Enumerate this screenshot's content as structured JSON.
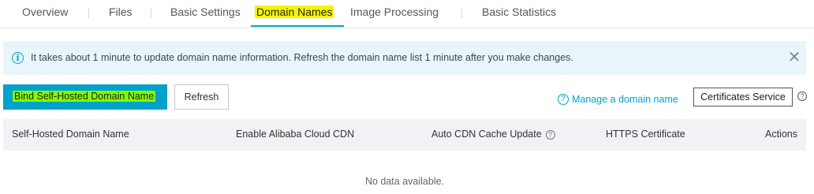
{
  "tabs": [
    {
      "label": "Overview"
    },
    {
      "label": "Files"
    },
    {
      "label": "Basic Settings"
    },
    {
      "label": "Domain Names",
      "active": true
    },
    {
      "label": "Image Processing"
    },
    {
      "label": "Basic Statistics"
    }
  ],
  "notice": {
    "icon": "info-icon",
    "text": "It takes about 1 minute to update domain name information. Refresh the domain name list 1 minute after you make changes.",
    "close_icon": "close-icon"
  },
  "toolbar": {
    "bind_label": "Bind Self-Hosted Domain Name",
    "refresh_label": "Refresh",
    "manage_link": "Manage a domain name",
    "certificates_label": "Certificates Service"
  },
  "table": {
    "columns": [
      {
        "label": "Self-Hosted Domain Name"
      },
      {
        "label": "Enable Alibaba Cloud CDN"
      },
      {
        "label": "Auto CDN Cache Update",
        "help_icon": true
      },
      {
        "label": "HTTPS Certificate"
      },
      {
        "label": "Actions"
      }
    ],
    "empty_text": "No data available."
  },
  "colors": {
    "accent": "#00a2ca",
    "tab_highlight": "#f5f500",
    "button_highlight": "#7fff00",
    "notice_bg": "#e8f6fb",
    "header_bg": "#f0f2f5"
  }
}
